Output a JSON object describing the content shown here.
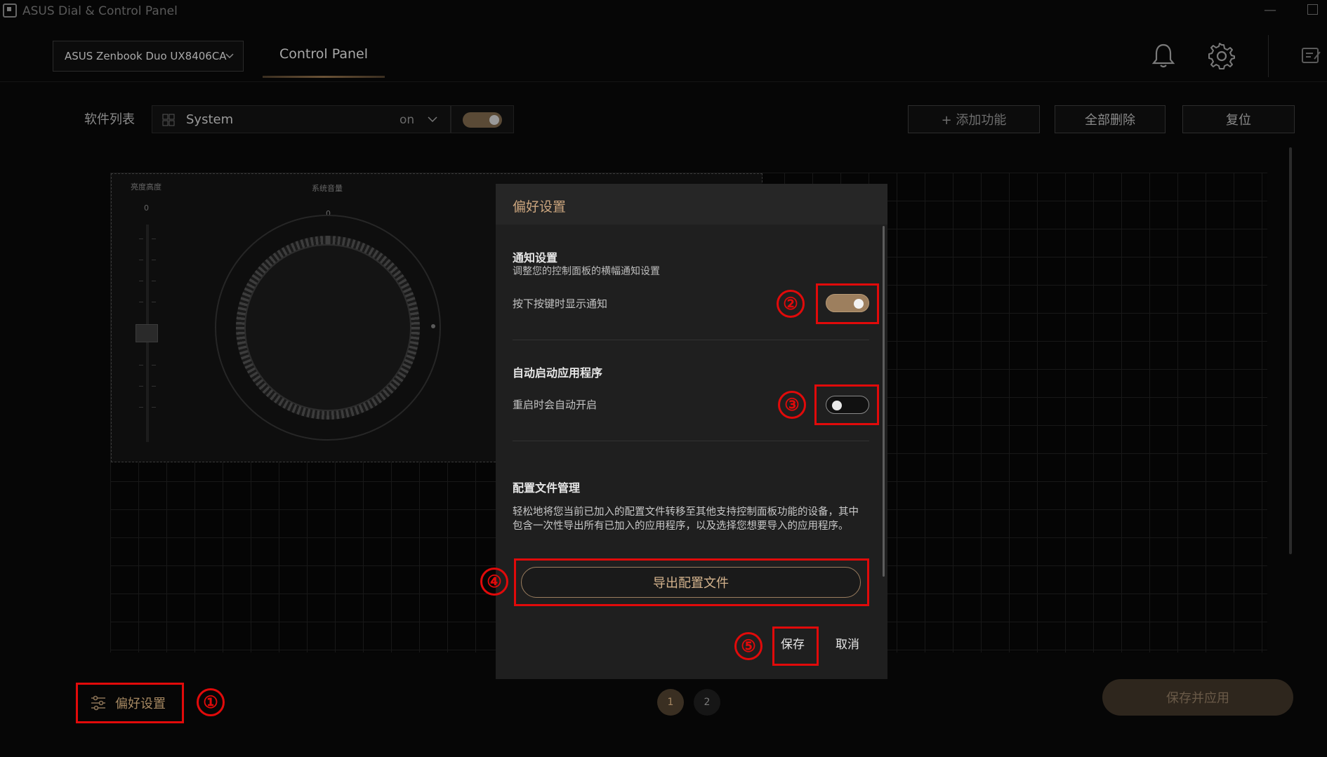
{
  "window": {
    "title": "ASUS Dial & Control Panel",
    "minimize": "—"
  },
  "header": {
    "device": "ASUS Zenbook Duo UX8406CA",
    "tab": "Control Panel"
  },
  "toolbar": {
    "software_list_label": "软件列表",
    "app_name": "System",
    "app_state": "on",
    "add_function": "+ 添加功能",
    "delete_all": "全部删除",
    "reset": "复位"
  },
  "canvas": {
    "slider_label": "亮度高度",
    "slider_value": "0",
    "dial_label": "系统音量",
    "dial_value": "0"
  },
  "modal": {
    "title": "偏好设置",
    "notify": {
      "title": "通知设置",
      "subtitle": "调整您的控制面板的横幅通知设置",
      "row_label": "按下按键时显示通知",
      "enabled": true
    },
    "autostart": {
      "title": "自动启动应用程序",
      "row_label": "重启时会自动开启",
      "enabled": false
    },
    "profile": {
      "title": "配置文件管理",
      "description": "轻松地将您当前已加入的配置文件转移至其他支持控制面板功能的设备，其中包含一次性导出所有已加入的应用程序，以及选择您想要导入的应用程序。",
      "export_button": "导出配置文件"
    },
    "save": "保存",
    "cancel": "取消"
  },
  "footer": {
    "preferences": "偏好设置",
    "pages": [
      "1",
      "2"
    ],
    "save_apply": "保存并应用"
  },
  "annotations": [
    "①",
    "②",
    "③",
    "④",
    "⑤"
  ],
  "colors": {
    "accent": "#cba57e",
    "annotation": "#e10a0a",
    "toggle_on": "#9d7f5e"
  }
}
